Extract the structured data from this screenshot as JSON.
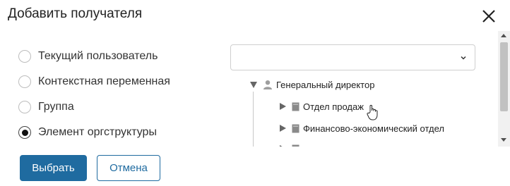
{
  "dialog": {
    "title": "Добавить получателя"
  },
  "recipient_types": [
    {
      "label": "Текущий пользователь",
      "selected": false
    },
    {
      "label": "Контекстная переменная",
      "selected": false
    },
    {
      "label": "Группа",
      "selected": false
    },
    {
      "label": "Элемент оргструктуры",
      "selected": true
    }
  ],
  "select": {
    "value": ""
  },
  "tree": {
    "root": {
      "label": "Генеральный директор",
      "icon": "person-icon",
      "expanded": true
    },
    "children": [
      {
        "label": "Отдел продаж",
        "icon": "department-icon",
        "expanded": false
      },
      {
        "label": "Финансово-экономический отдел",
        "icon": "department-icon",
        "expanded": false
      }
    ]
  },
  "buttons": {
    "select_label": "Выбрать",
    "cancel_label": "Отмена"
  },
  "colors": {
    "primary": "#1f6ba0",
    "icon_gray": "#9e9e9e"
  }
}
